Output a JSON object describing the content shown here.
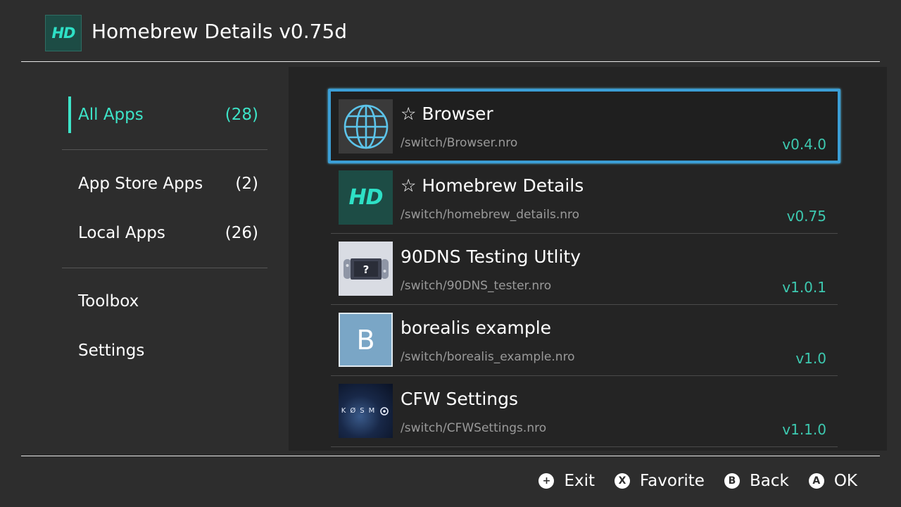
{
  "header": {
    "logo_text": "HD",
    "title": "Homebrew Details v0.75d"
  },
  "sidebar": {
    "items": [
      {
        "label": "All Apps",
        "count": "(28)",
        "active": true
      },
      {
        "label": "App Store Apps",
        "count": "(2)"
      },
      {
        "label": "Local Apps",
        "count": "(26)"
      },
      {
        "label": "Toolbox",
        "count": ""
      },
      {
        "label": "Settings",
        "count": ""
      }
    ]
  },
  "apps": [
    {
      "title": "☆ Browser",
      "path": "/switch/Browser.nro",
      "version": "v0.4.0",
      "icon": "globe-icon",
      "selected": true
    },
    {
      "title": "☆ Homebrew Details",
      "path": "/switch/homebrew_details.nro",
      "version": "v0.75",
      "icon": "hd-logo-icon",
      "icon_text": "HD"
    },
    {
      "title": "90DNS Testing Utlity",
      "path": "/switch/90DNS_tester.nro",
      "version": "v1.0.1",
      "icon": "switch-console-icon"
    },
    {
      "title": "borealis example",
      "path": "/switch/borealis_example.nro",
      "version": "v1.0",
      "icon": "letter-b-icon",
      "icon_text": "B"
    },
    {
      "title": "CFW Settings",
      "path": "/switch/CFWSettings.nro",
      "version": "v1.1.0",
      "icon": "kosmos-icon",
      "icon_text": "KØSM"
    }
  ],
  "footer": {
    "hints": [
      {
        "glyph": "+",
        "label": "Exit"
      },
      {
        "glyph": "X",
        "label": "Favorite"
      },
      {
        "glyph": "B",
        "label": "Back"
      },
      {
        "glyph": "A",
        "label": "OK"
      }
    ]
  },
  "colors": {
    "background": "#2d2d2d",
    "list_background": "#242424",
    "accent_teal": "#3de4c8",
    "version_teal": "#3dc9b0",
    "selection_blue": "#3b9ed6"
  }
}
